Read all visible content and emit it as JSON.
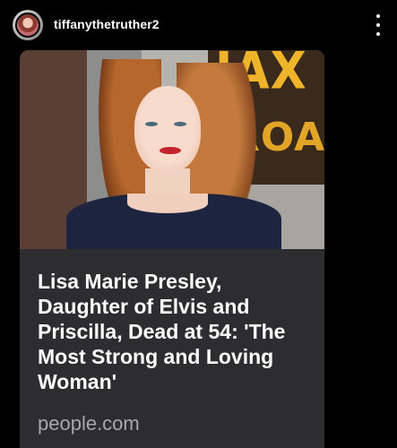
{
  "post": {
    "username": "tiffanythetruther2",
    "avatar_icon": "profile-avatar",
    "more_icon": "vertical-ellipsis-icon"
  },
  "link_card": {
    "headline": "Lisa Marie Presley, Daughter of Elvis and Priscilla, Dead at 54: 'The Most Strong and Loving Woman'",
    "source": "people.com"
  },
  "colors": {
    "background": "#000000",
    "card": "#2d2d30",
    "source_text": "#a8a8ad"
  }
}
